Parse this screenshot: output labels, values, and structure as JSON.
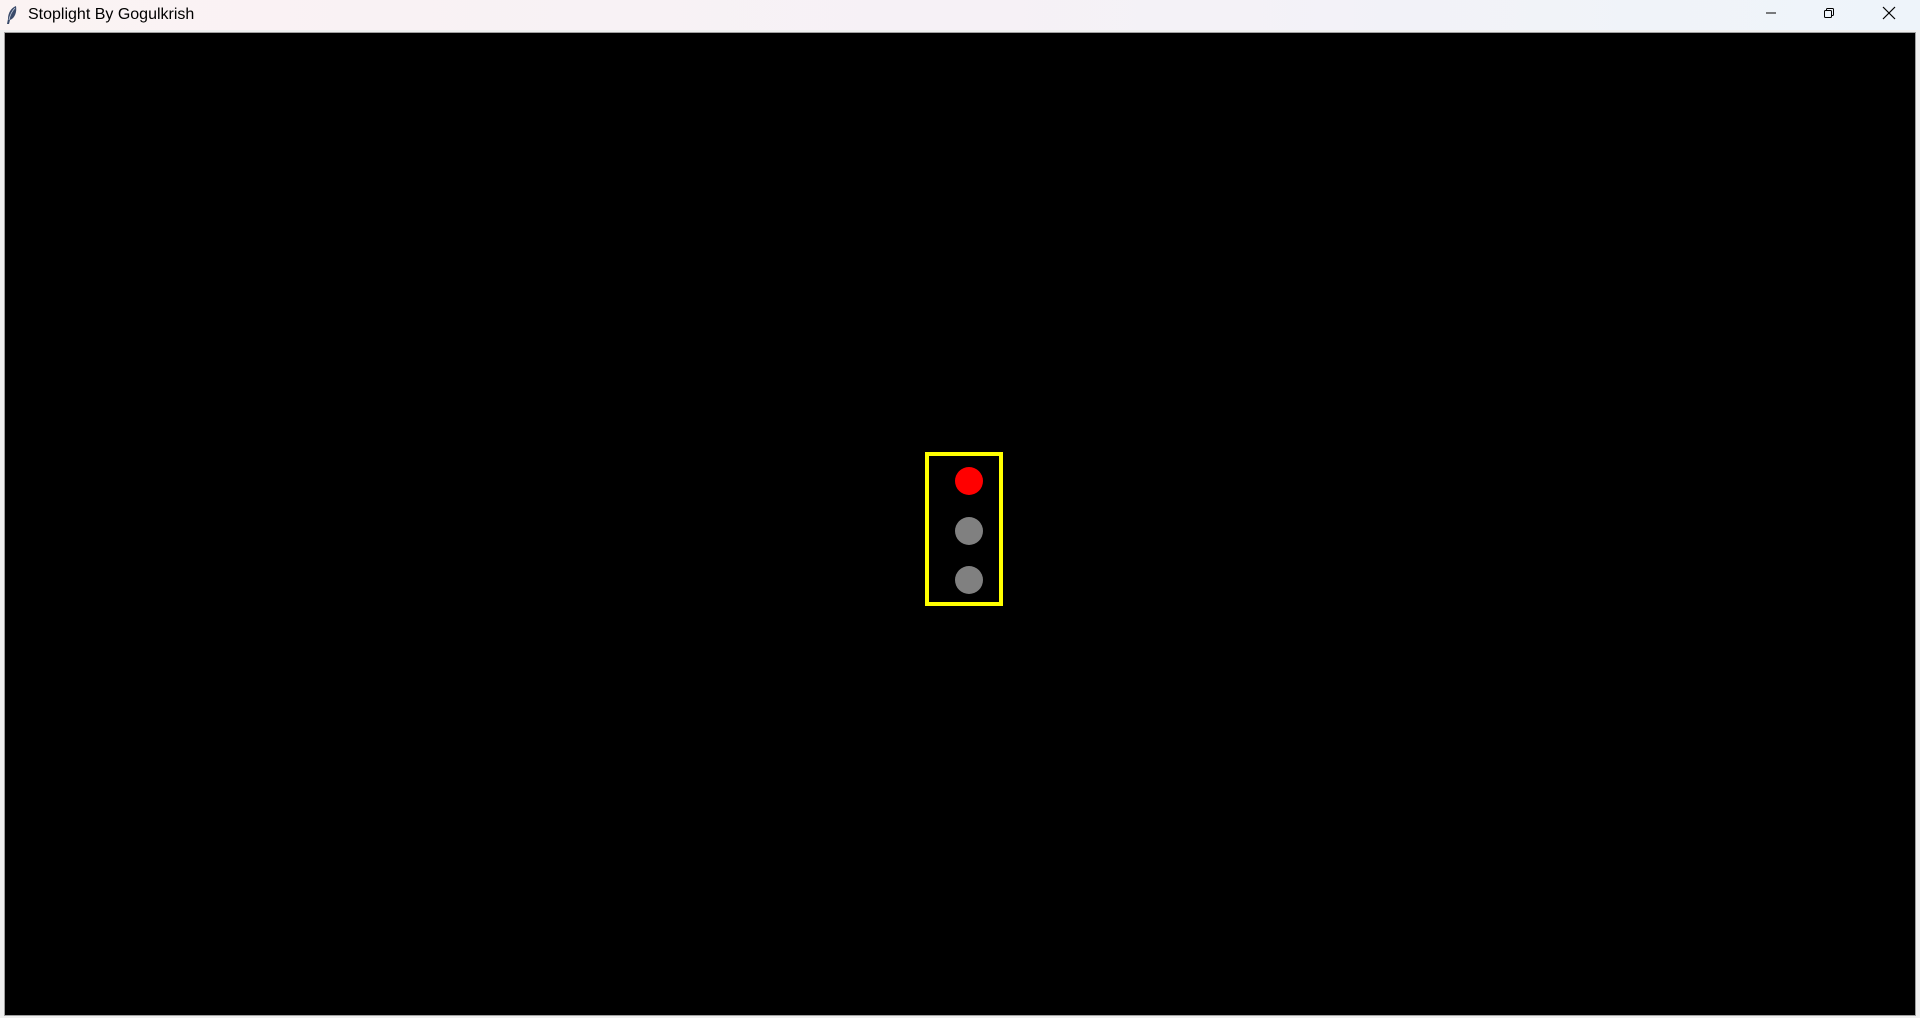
{
  "window": {
    "title": "Stoplight By Gogulkrish",
    "icon": "feather-icon",
    "controls": {
      "minimize_icon": "minimize-icon",
      "restore_icon": "restore-icon",
      "close_icon": "close-icon"
    }
  },
  "canvas": {
    "background": "#000000",
    "stoplight": {
      "housing_color": "#ffff00",
      "lamps": [
        {
          "name": "red",
          "state": "on",
          "color": "#ff0000"
        },
        {
          "name": "yellow",
          "state": "off",
          "color": "#808080"
        },
        {
          "name": "green",
          "state": "off",
          "color": "#808080"
        }
      ]
    }
  }
}
